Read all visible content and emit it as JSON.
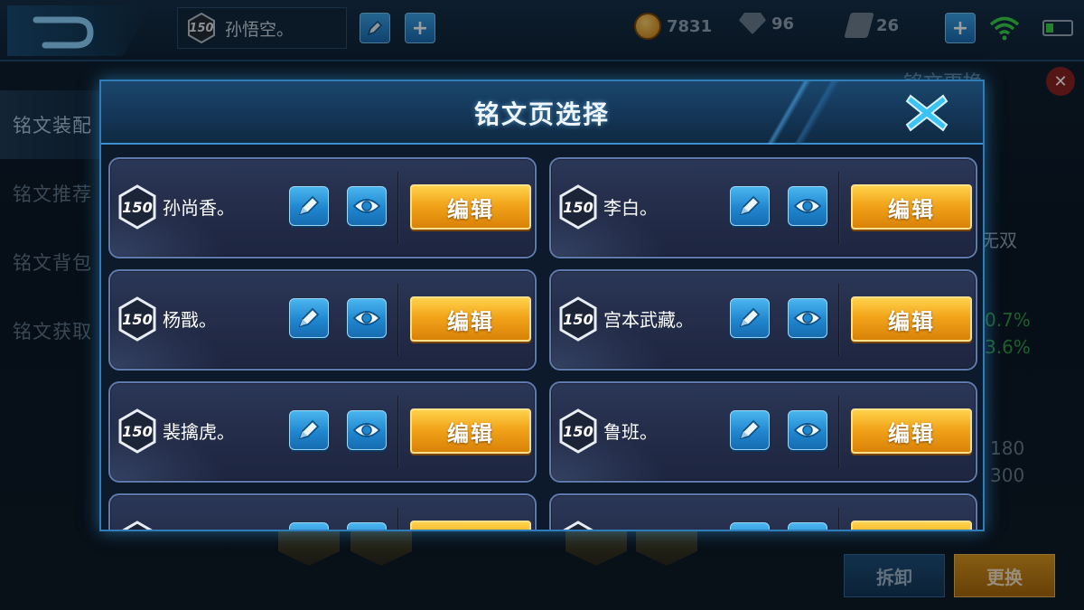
{
  "topbar": {
    "player_level": "150",
    "player_name": "孙悟空。",
    "gold": "7831",
    "diamonds": "96",
    "tickets": "26"
  },
  "sidenav": {
    "items": [
      {
        "label": "铭文装配"
      },
      {
        "label": "铭文推荐"
      },
      {
        "label": "铭文背包"
      },
      {
        "label": "铭文获取"
      }
    ]
  },
  "background_panel": {
    "title": "铭文更换",
    "partial_texts": [
      "无双",
      "0.7%",
      "3.6%",
      "180",
      "300"
    ],
    "remove_label": "拆卸",
    "replace_label": "更换"
  },
  "modal": {
    "title": "铭文页选择",
    "pages": [
      {
        "level": "150",
        "name": "孙尚香。",
        "edit_label": "编辑"
      },
      {
        "level": "150",
        "name": "李白。",
        "edit_label": "编辑"
      },
      {
        "level": "150",
        "name": "杨戬。",
        "edit_label": "编辑"
      },
      {
        "level": "150",
        "name": "宫本武藏。",
        "edit_label": "编辑"
      },
      {
        "level": "150",
        "name": "裴擒虎。",
        "edit_label": "编辑"
      },
      {
        "level": "150",
        "name": "鲁班。",
        "edit_label": "编辑"
      },
      {
        "level": "",
        "name": "",
        "edit_label": ""
      },
      {
        "level": "",
        "name": "",
        "edit_label": ""
      }
    ]
  },
  "colors": {
    "accent_blue": "#1f86cf",
    "edit_gold": "#f2a41a",
    "close_cyan": "#3cc3f5",
    "wifi_green": "#37d24a"
  },
  "icons": {
    "back": "back-arrow-icon",
    "rename": "pencil-icon",
    "view": "eye-icon",
    "close": "close-x-icon"
  }
}
